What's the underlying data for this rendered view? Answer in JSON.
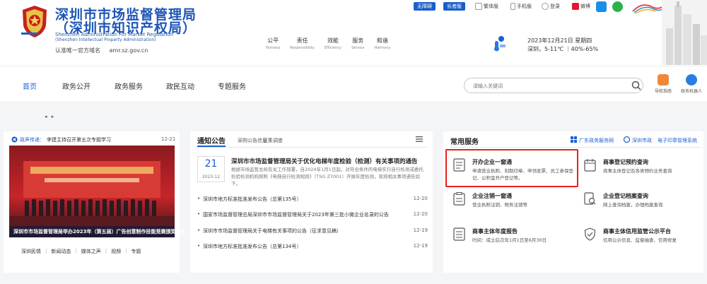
{
  "header": {
    "title_line1": "深圳市市场监督管理局",
    "title_line2": "（深圳市知识产权局）",
    "title_en1": "Shenzhen Administration For Market Regulation",
    "title_en2": "(Shenzhen Intellectual Property Administration)",
    "site_label": "认准唯一官方域名",
    "site_domain": "amr.sz.gov.cn",
    "values": [
      {
        "cn": "公平",
        "en": "Fairness"
      },
      {
        "cn": "责任",
        "en": "Responsibility"
      },
      {
        "cn": "效能",
        "en": "Efficiency"
      },
      {
        "cn": "服务",
        "en": "Service"
      },
      {
        "cn": "和谐",
        "en": "Harmony"
      }
    ],
    "toolbar": {
      "accessible": "无障碍",
      "elder": "长者版",
      "traditional": "繁体版",
      "mobile": "手机版",
      "login": "登录",
      "weibo": "微博"
    },
    "weather": {
      "date": "2023年12月21日 星期四",
      "temp": "深圳，5-11℃ ｜40%-65%"
    }
  },
  "nav": {
    "items": [
      "首页",
      "政务公开",
      "政务服务",
      "政民互动",
      "专题服务"
    ],
    "search_placeholder": "请输入关键词",
    "quick": [
      "导航指南",
      "政务机器人"
    ]
  },
  "body": {
    "pager": "◂ ▸",
    "announce": {
      "label": "政声传递：",
      "text": "李建主持召开第五次专题学习",
      "date": "12-21"
    },
    "photo_caption": "深圳市市场监督管理局举办2023年（第五届）广告创意制作技能竞赛颁奖典礼",
    "left_links": [
      "深圳民情",
      "新闻动态",
      "媒体之声",
      "视频",
      "专题"
    ],
    "notice": {
      "tabs": [
        "通知公告",
        "采购公告信息",
        "征集调查"
      ],
      "featured": {
        "day": "21",
        "ym": "2023-12",
        "title": "深圳市市场监督管理局关于优化电梯年度检验（检测）有关事项的通告",
        "summary": "根据市场监管总局有关工作部署，自2024年1月1日起，对符合条件的电梯实行自行检测或委托检验检测机构按照《电梯自行检测规则》（TSG Z7001）开展年度检测，现将相关事项通告如下。"
      },
      "items": [
        {
          "title": "深圳市地方标准批准发布公告（总第135号）",
          "date": "12-20"
        },
        {
          "title": "国家市场监督管理总局深圳市市场监督管理局关于2023年第三批小微企业名录的公告",
          "date": "12-20"
        },
        {
          "title": "深圳市市场监督管理局关于电梯有关事项的公告（征求意见稿）",
          "date": "12-19"
        },
        {
          "title": "深圳市地方标准批准发布公告（总第134号）",
          "date": "12-19"
        }
      ]
    },
    "services": {
      "title": "常用服务",
      "links": [
        "广东政务服务网",
        "深圳市政",
        "电子印章管理系统"
      ],
      "items": [
        {
          "title": "开办企业一窗通",
          "desc": "申请营业执照、刻制印章、申领发票、员工参保登记、公积金开户登记等。"
        },
        {
          "title": "商事登记预约查询",
          "desc": "商事主体登记及各类预约业务查询"
        },
        {
          "title": "企业注销一窗通",
          "desc": "营业执照注销、税务注销等"
        },
        {
          "title": "企业登记档案查询",
          "desc": "网上查询档案，办理档案查询"
        },
        {
          "title": "商事主体年度报告",
          "desc": "时间：成立后次年1月1日至6月30日"
        },
        {
          "title": "商事主体信用监管公示平台",
          "desc": "信用公示信息、监督抽查、信用修复"
        }
      ]
    }
  },
  "colors": {
    "brand": "#1c55b7",
    "link": "#1c5fd0",
    "highlight": "#e8201c",
    "bg": "#f4f5f7"
  }
}
